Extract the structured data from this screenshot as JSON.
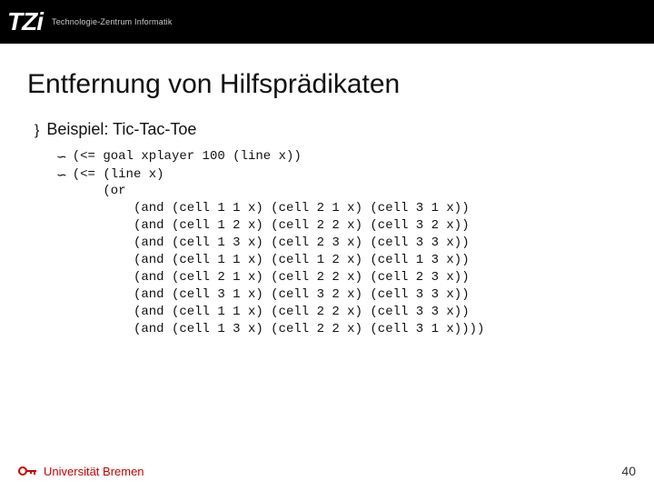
{
  "header": {
    "logo_text": "TZi",
    "subtitle": "Technologie-Zentrum Informatik"
  },
  "title": "Entfernung von Hilfsprädikaten",
  "bullets": {
    "main": "Beispiel: Tic-Tac-Toe",
    "sub1_code": "(<= goal xplayer 100 (line x))",
    "sub2_code": "(<= (line x)\n    (or\n        (and (cell 1 1 x) (cell 2 1 x) (cell 3 1 x))\n        (and (cell 1 2 x) (cell 2 2 x) (cell 3 2 x))\n        (and (cell 1 3 x) (cell 2 3 x) (cell 3 3 x))\n        (and (cell 1 1 x) (cell 1 2 x) (cell 1 3 x))\n        (and (cell 2 1 x) (cell 2 2 x) (cell 2 3 x))\n        (and (cell 3 1 x) (cell 3 2 x) (cell 3 3 x))\n        (and (cell 1 1 x) (cell 2 2 x) (cell 3 3 x))\n        (and (cell 1 3 x) (cell 2 2 x) (cell 3 1 x))))"
  },
  "footer": {
    "university": "Universität Bremen",
    "page": "40"
  },
  "glyphs": {
    "main_bullet": "}",
    "sub_bullet": "∽"
  }
}
